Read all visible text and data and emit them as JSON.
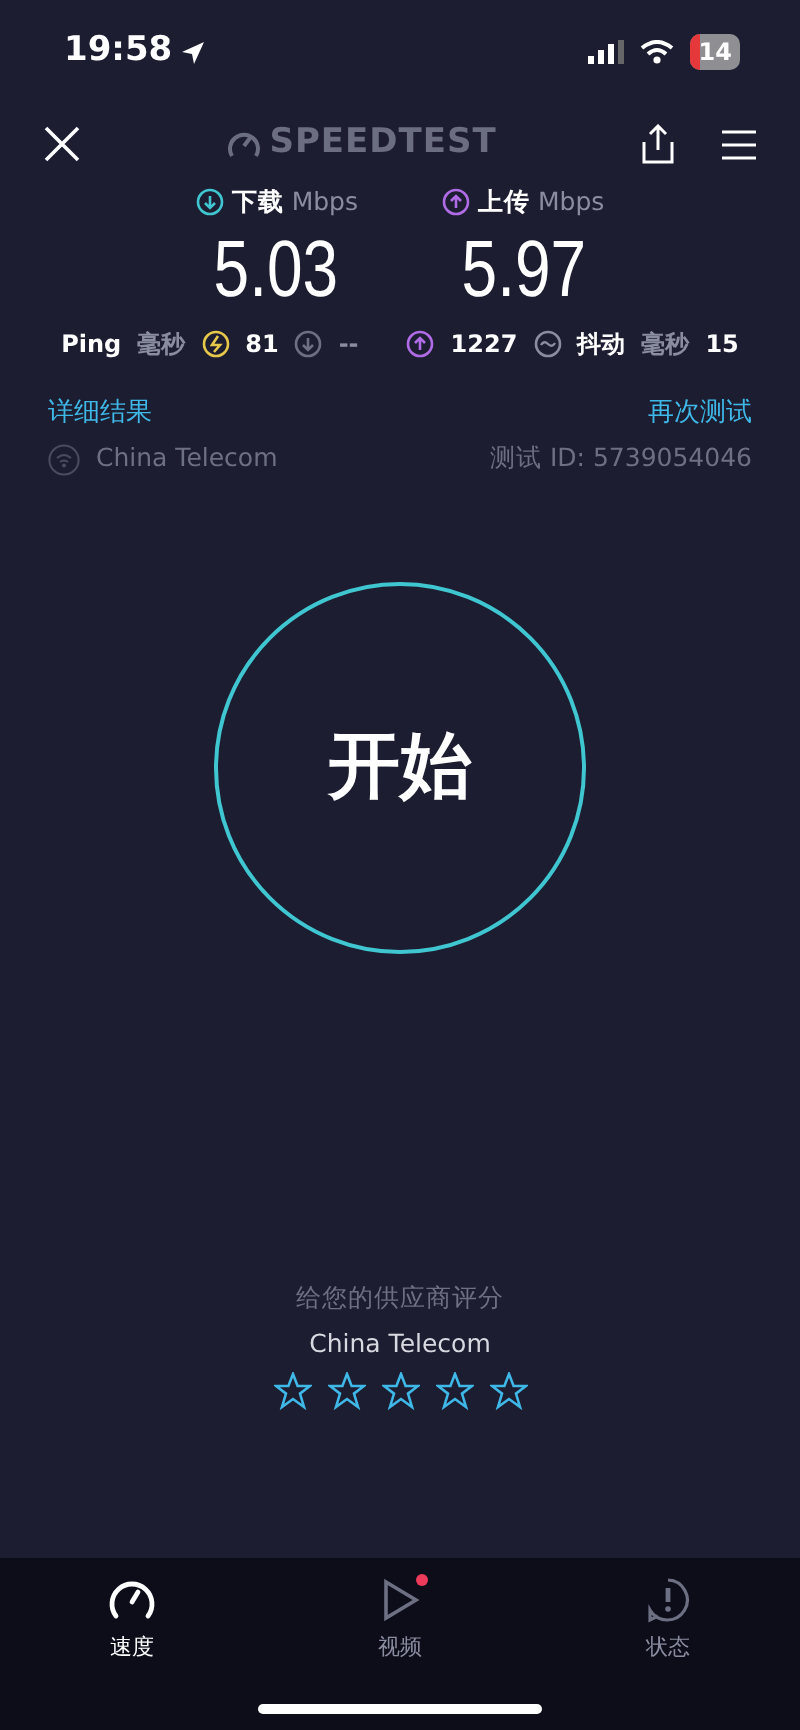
{
  "status_bar": {
    "time": "19:58",
    "battery": "14"
  },
  "header": {
    "logo": "SPEEDTEST"
  },
  "results": [
    {
      "kind": "download",
      "label": "下载",
      "unit": "Mbps",
      "value": "5.03"
    },
    {
      "kind": "upload",
      "label": "上传",
      "unit": "Mbps",
      "value": "5.97"
    }
  ],
  "metrics": {
    "ping_label": "Ping",
    "ping_unit": "毫秒",
    "idle": "81",
    "download_latency": "--",
    "upload_latency": "1227",
    "jitter_label": "抖动",
    "jitter_unit": "毫秒",
    "jitter": "15"
  },
  "links": {
    "details": "详细结果",
    "retest": "再次测试"
  },
  "provider": "China Telecom",
  "test_id": "测试 ID: 5739054046",
  "start_button": "开始",
  "rating": {
    "prompt": "给您的供应商评分",
    "provider": "China Telecom",
    "stars": 0
  },
  "tabs": [
    {
      "kind": "speed",
      "label": "速度",
      "selected": true,
      "notification": false
    },
    {
      "kind": "video",
      "label": "视频",
      "selected": false,
      "notification": true
    },
    {
      "kind": "status",
      "label": "状态",
      "selected": false,
      "notification": false
    }
  ]
}
